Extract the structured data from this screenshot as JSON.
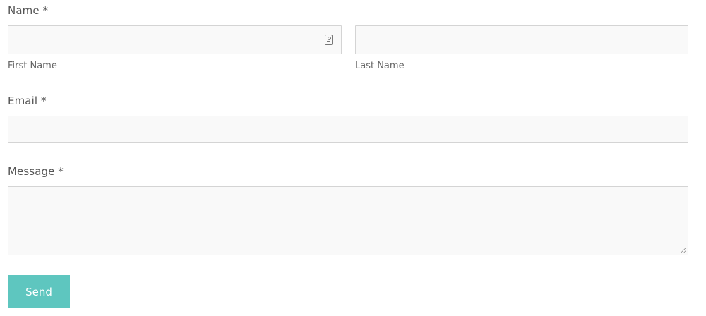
{
  "name_section": {
    "label": "Name *",
    "first_name": {
      "value": "",
      "sublabel": "First Name",
      "icon": "contact-card-icon"
    },
    "last_name": {
      "value": "",
      "sublabel": "Last Name"
    }
  },
  "email_section": {
    "label": "Email *",
    "value": ""
  },
  "message_section": {
    "label": "Message *",
    "value": ""
  },
  "submit": {
    "label": "Send",
    "color": "#5ec6bf"
  }
}
